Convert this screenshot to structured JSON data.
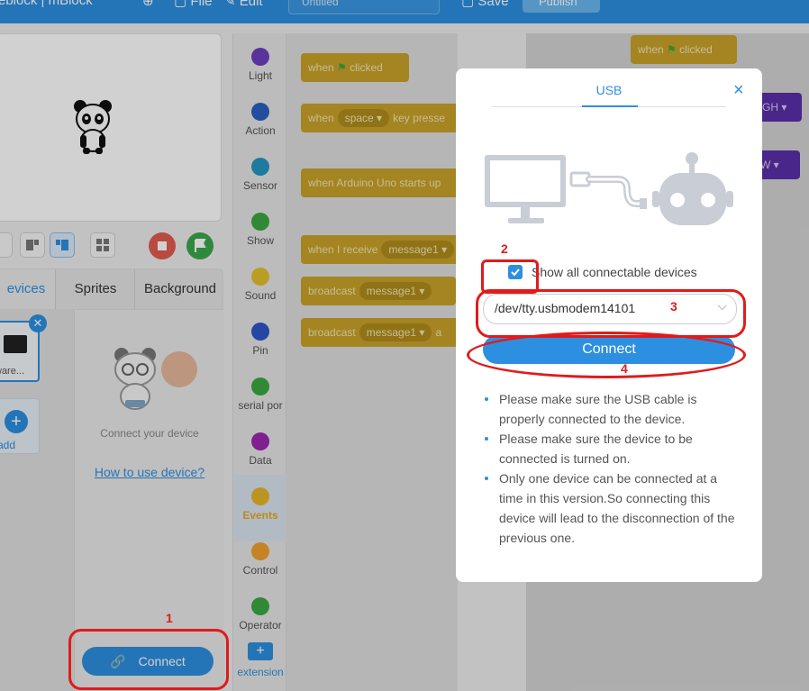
{
  "topbar": {
    "brand": "eblock | mBlock",
    "file": "File",
    "edit": "Edit",
    "project_name": "Untitled",
    "save": "Save",
    "publish": "Publish"
  },
  "panel_tabs": [
    "evices",
    "Sprites",
    "Background"
  ],
  "device": {
    "name": "ware...",
    "add_label": "add",
    "connect_hint": "Connect your device",
    "how_to": "How to use device?",
    "connect_button": "Connect"
  },
  "categories": [
    {
      "label": "Light",
      "color": "#6c3fbf"
    },
    {
      "label": "Action",
      "color": "#2b60c4"
    },
    {
      "label": "Sensor",
      "color": "#2496c2"
    },
    {
      "label": "Show",
      "color": "#3aa841"
    },
    {
      "label": "Sound",
      "color": "#e2c12b"
    },
    {
      "label": "Pin",
      "color": "#2f56c8"
    },
    {
      "label": "serial por",
      "color": "#3aa841"
    },
    {
      "label": "Data",
      "color": "#9c27b0"
    },
    {
      "label": "Events",
      "color": "#e6b52a"
    },
    {
      "label": "Control",
      "color": "#f0a030"
    },
    {
      "label": "Operator",
      "color": "#3aa841"
    }
  ],
  "extension_label": "extension",
  "blocks": {
    "when": "when",
    "clicked": "clicked",
    "key_pressed": "key presse",
    "space": "space",
    "arduino": "when Arduino Uno starts up",
    "receive": "when I receive",
    "message1": "message1",
    "broadcast": "broadcast",
    "broadcast_and": "a"
  },
  "workspace": {
    "hat": "when",
    "hat_clicked": "clicked",
    "high": "GH",
    "low": "W"
  },
  "modal": {
    "tab": "USB",
    "close": "×",
    "show_all_label": "Show all connectable devices",
    "port_value": "/dev/tty.usbmodem14101",
    "connect_label": "Connect",
    "tips": [
      "Please make sure the USB cable is properly connected to the device.",
      "Please make sure the device to be connected is turned on.",
      "Only one device can be connected at a time in this version.So connecting this device will lead to the disconnection of the previous one."
    ]
  },
  "annotations": {
    "n1": "1",
    "n2": "2",
    "n3": "3",
    "n4": "4"
  }
}
